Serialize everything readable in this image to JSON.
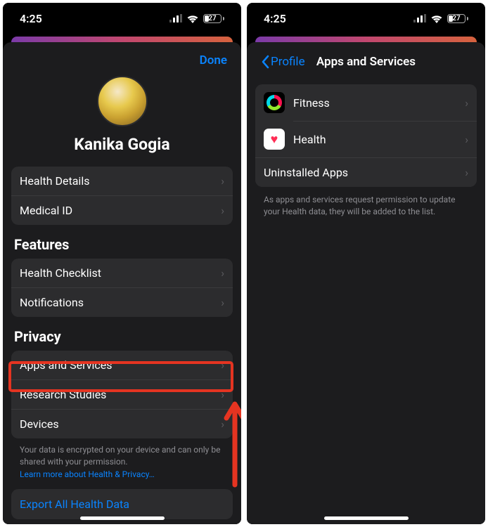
{
  "status": {
    "time": "4:25",
    "battery_percent": "27"
  },
  "left": {
    "done": "Done",
    "user_name": "Kanika Gogia",
    "group1": {
      "health_details": "Health Details",
      "medical_id": "Medical ID"
    },
    "features_header": "Features",
    "features": {
      "health_checklist": "Health Checklist",
      "notifications": "Notifications"
    },
    "privacy_header": "Privacy",
    "privacy": {
      "apps_services": "Apps and Services",
      "research": "Research Studies",
      "devices": "Devices"
    },
    "footer_text": "Your data is encrypted on your device and can only be shared with your permission.",
    "footer_link": "Learn more about Health & Privacy…",
    "export": "Export All Health Data"
  },
  "right": {
    "back_label": "Profile",
    "title": "Apps and Services",
    "items": {
      "fitness": "Fitness",
      "health": "Health",
      "uninstalled": "Uninstalled Apps"
    },
    "footer": "As apps and services request permission to update your Health data, they will be added to the list."
  }
}
